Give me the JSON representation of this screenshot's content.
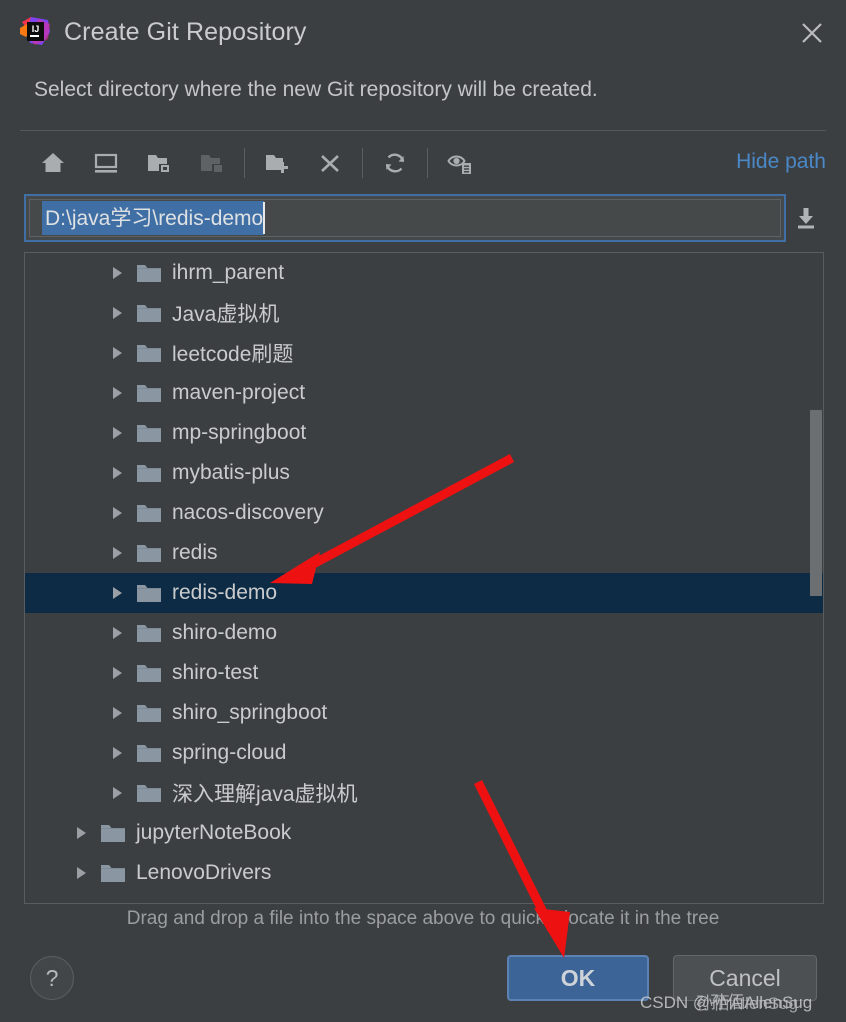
{
  "window": {
    "title": "Create Git Repository",
    "app_icon": "intellij-idea-logo",
    "close_icon": "close-icon",
    "subtitle": "Select directory where the new Git repository will be created."
  },
  "toolbar": {
    "hide_path_label": "Hide path",
    "buttons": [
      {
        "name": "home-icon",
        "tooltip": "Home",
        "disabled": false
      },
      {
        "name": "desktop-icon",
        "tooltip": "Desktop",
        "disabled": false
      },
      {
        "name": "project-folder-icon",
        "tooltip": "Project Directory",
        "disabled": false
      },
      {
        "name": "module-folder-icon",
        "tooltip": "Module Directory",
        "disabled": true
      },
      {
        "name": "new-folder-icon",
        "tooltip": "New Folder",
        "disabled": false
      },
      {
        "name": "delete-icon",
        "tooltip": "Delete",
        "disabled": false
      },
      {
        "name": "refresh-icon",
        "tooltip": "Refresh",
        "disabled": false
      },
      {
        "name": "show-hidden-files-icon",
        "tooltip": "Show Hidden Files",
        "disabled": false
      }
    ]
  },
  "path_field": {
    "value": "D:\\java学习\\redis-demo",
    "placeholder": "",
    "selected": true,
    "download_icon": "download-icon"
  },
  "tree": {
    "rows": [
      {
        "label": "ihrm_parent",
        "indent": 2,
        "selected": false
      },
      {
        "label": "Java虚拟机",
        "indent": 2,
        "selected": false
      },
      {
        "label": "leetcode刷题",
        "indent": 2,
        "selected": false
      },
      {
        "label": "maven-project",
        "indent": 2,
        "selected": false
      },
      {
        "label": "mp-springboot",
        "indent": 2,
        "selected": false
      },
      {
        "label": "mybatis-plus",
        "indent": 2,
        "selected": false
      },
      {
        "label": "nacos-discovery",
        "indent": 2,
        "selected": false
      },
      {
        "label": "redis",
        "indent": 2,
        "selected": false
      },
      {
        "label": "redis-demo",
        "indent": 2,
        "selected": true
      },
      {
        "label": "shiro-demo",
        "indent": 2,
        "selected": false
      },
      {
        "label": "shiro-test",
        "indent": 2,
        "selected": false
      },
      {
        "label": "shiro_springboot",
        "indent": 2,
        "selected": false
      },
      {
        "label": "spring-cloud",
        "indent": 2,
        "selected": false
      },
      {
        "label": "深入理解java虚拟机",
        "indent": 2,
        "selected": false
      },
      {
        "label": "jupyterNoteBook",
        "indent": 1,
        "selected": false
      },
      {
        "label": "LenovoDrivers",
        "indent": 1,
        "selected": false
      }
    ],
    "scrollbar": "vertical-scrollbar"
  },
  "hint": "Drag and drop a file into the space above to quickly locate it in the tree",
  "footer": {
    "help_label": "?",
    "ok_label": "OK",
    "cancel_label": "Cancel"
  },
  "annotations": {
    "arrow_to_tree_row": "red-arrow-pointing-to-redis-demo",
    "arrow_to_ok": "red-arrow-pointing-to-ok-button"
  },
  "watermark": {
    "line1": "CSDN @孙佰AllenSug",
    "line2": "孙佰AllenSug"
  },
  "colors": {
    "dialog_bg": "#3c3f41",
    "selection_blue": "#3f6fa5",
    "tree_selected_bg": "#0d2b44",
    "link_blue": "#4a88c7",
    "primary_button": "#3c6497",
    "arrow_red": "#ee1111"
  }
}
